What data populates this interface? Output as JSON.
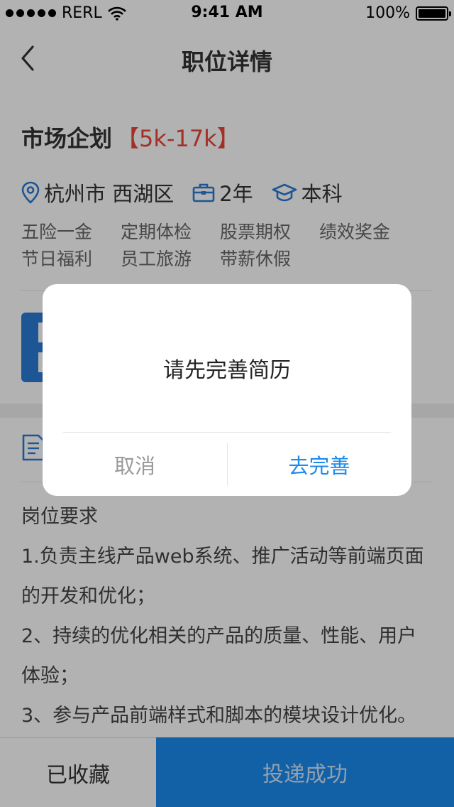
{
  "status_bar": {
    "carrier": "RERL",
    "time": "9:41 AM",
    "battery": "100%"
  },
  "nav": {
    "title": "职位详情"
  },
  "job": {
    "title": "市场企划",
    "salary": "【5k-17k】",
    "location": "杭州市 西湖区",
    "experience": "2年",
    "education": "本科",
    "tags": [
      "五险一金",
      "定期体检",
      "股票期权",
      "绩效奖金",
      "节日福利",
      "员工旅游",
      "带薪休假"
    ]
  },
  "description": {
    "lines": [
      "岗位要求",
      "1.负责主线产品web系统、推广活动等前端页面",
      "的开发和优化；",
      "2、持续的优化相关的产品的质量、性能、用户",
      "体验；",
      "3、参与产品前端样式和脚本的模块设计优化。"
    ]
  },
  "bottom_bar": {
    "favorite_label": "已收藏",
    "apply_label": "投递成功"
  },
  "dialog": {
    "message": "请先完善简历",
    "cancel_label": "取消",
    "confirm_label": "去完善"
  },
  "colors": {
    "accent": "#1a8aee",
    "salary": "#e8453c",
    "icon_blue": "#2b7bd6"
  }
}
